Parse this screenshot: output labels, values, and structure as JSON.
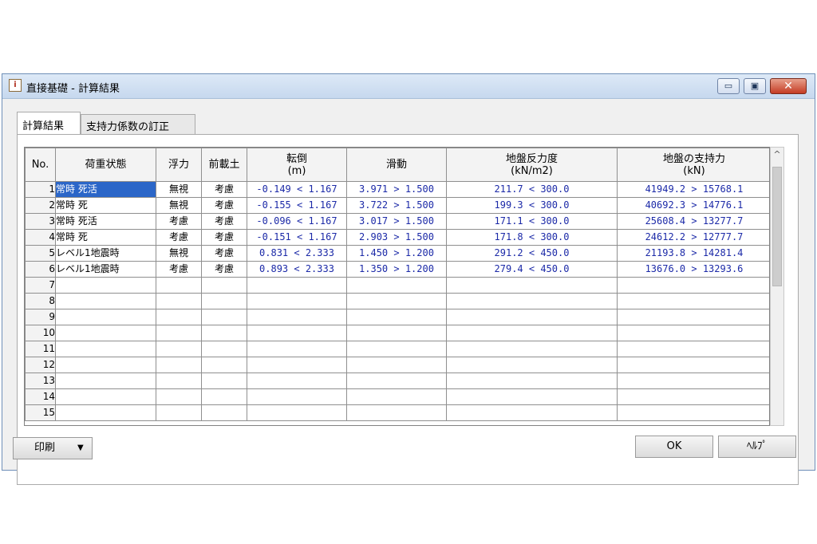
{
  "window": {
    "title": "直接基礎 - 計算結果",
    "icon": "app-icon",
    "icon_text": "i",
    "minimize_glyph": "▭",
    "maximize_glyph": "▣",
    "close_glyph": "✕"
  },
  "tabs": [
    {
      "label": "計算結果",
      "active": true
    },
    {
      "label": "支持力係数の訂正",
      "active": false
    }
  ],
  "table": {
    "headers": {
      "no": "No.",
      "load_case": "荷重状態",
      "buoyancy": "浮力",
      "front_soil": "前載土",
      "overturn": "転倒",
      "overturn_unit": "(m)",
      "sliding": "滑動",
      "reaction": "地盤反力度",
      "reaction_unit": "(kN/m2)",
      "bearing": "地盤の支持力",
      "bearing_unit": "(kN)"
    },
    "rows": [
      {
        "no": "1",
        "load_case": "常時 死活",
        "buoyancy": "無視",
        "front_soil": "考慮",
        "overturn": "-0.149 <  1.167",
        "sliding": "3.971 >  1.500",
        "reaction": "211.7 <  300.0",
        "bearing": "41949.2 > 15768.1",
        "selected": true
      },
      {
        "no": "2",
        "load_case": "常時 死",
        "buoyancy": "無視",
        "front_soil": "考慮",
        "overturn": "-0.155 <  1.167",
        "sliding": "3.722 >  1.500",
        "reaction": "199.3 <  300.0",
        "bearing": "40692.3 > 14776.1"
      },
      {
        "no": "3",
        "load_case": "常時 死活",
        "buoyancy": "考慮",
        "front_soil": "考慮",
        "overturn": "-0.096 <  1.167",
        "sliding": "3.017 >  1.500",
        "reaction": "171.1 <  300.0",
        "bearing": "25608.4 > 13277.7"
      },
      {
        "no": "4",
        "load_case": "常時 死",
        "buoyancy": "考慮",
        "front_soil": "考慮",
        "overturn": "-0.151 <  1.167",
        "sliding": "2.903 >  1.500",
        "reaction": "171.8 <  300.0",
        "bearing": "24612.2 > 12777.7"
      },
      {
        "no": "5",
        "load_case": "レベル1地震時",
        "buoyancy": "無視",
        "front_soil": "考慮",
        "overturn": "0.831 <  2.333",
        "sliding": "1.450 >  1.200",
        "reaction": "291.2 <  450.0",
        "bearing": "21193.8 > 14281.4"
      },
      {
        "no": "6",
        "load_case": "レベル1地震時",
        "buoyancy": "考慮",
        "front_soil": "考慮",
        "overturn": "0.893 <  2.333",
        "sliding": "1.350 >  1.200",
        "reaction": "279.4 <  450.0",
        "bearing": "13676.0 > 13293.6"
      },
      {
        "no": "7"
      },
      {
        "no": "8"
      },
      {
        "no": "9"
      },
      {
        "no": "10"
      },
      {
        "no": "11"
      },
      {
        "no": "12"
      },
      {
        "no": "13"
      },
      {
        "no": "14"
      },
      {
        "no": "15"
      }
    ]
  },
  "scrollbar": {
    "up_glyph": "^"
  },
  "buttons": {
    "print_label": "印刷",
    "print_caret": "▼",
    "ok_label": "OK",
    "help_label": "ﾍﾙﾌﾟ"
  },
  "colors": {
    "value_text": "#1c2aa8",
    "selection": "#2b66c8",
    "close_button": "#c43c24"
  }
}
